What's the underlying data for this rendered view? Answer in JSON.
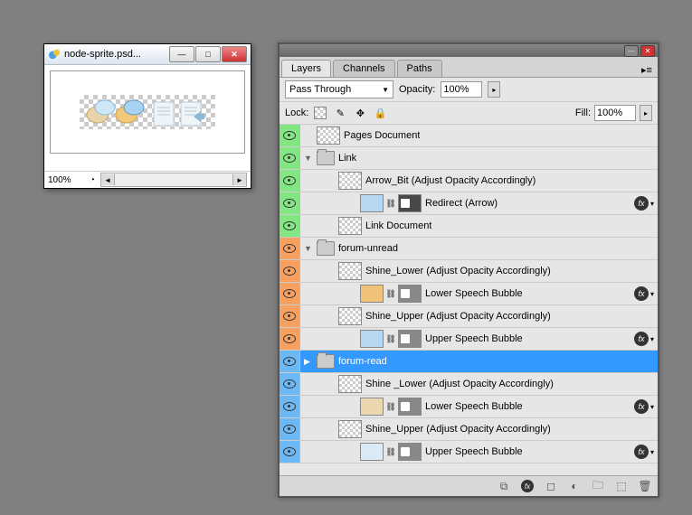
{
  "document_window": {
    "title": "node-sprite.psd...",
    "zoom": "100%"
  },
  "panel": {
    "tabs": [
      "Layers",
      "Channels",
      "Paths"
    ],
    "active_tab": "Layers",
    "blend_mode": "Pass Through",
    "opacity_label": "Opacity:",
    "opacity_value": "100%",
    "lock_label": "Lock:",
    "fill_label": "Fill:",
    "fill_value": "100%"
  },
  "layers": [
    {
      "color": "green",
      "type": "layer",
      "indent": 0,
      "thumb": "trans",
      "name": "Pages Document"
    },
    {
      "color": "green",
      "type": "group",
      "indent": 0,
      "expand": "open",
      "name": "Link"
    },
    {
      "color": "green",
      "type": "layer",
      "indent": 1,
      "thumb": "trans",
      "name": "Arrow_Bit (Adjust Opacity Accordingly)"
    },
    {
      "color": "green",
      "type": "layer",
      "indent": 2,
      "thumb": "#b7d6ef",
      "mask": "dark",
      "name": "Redirect (Arrow)",
      "fx": true
    },
    {
      "color": "green",
      "type": "layer",
      "indent": 1,
      "thumb": "trans",
      "name": "Link Document"
    },
    {
      "color": "orange",
      "type": "group",
      "indent": 0,
      "expand": "open",
      "name": "forum-unread"
    },
    {
      "color": "orange",
      "type": "layer",
      "indent": 1,
      "thumb": "trans",
      "name": "Shine_Lower (Adjust Opacity Accordingly)"
    },
    {
      "color": "orange",
      "type": "layer",
      "indent": 2,
      "thumb": "#f1c27a",
      "mask": "light",
      "name": "Lower Speech Bubble",
      "fx": true
    },
    {
      "color": "orange",
      "type": "layer",
      "indent": 1,
      "thumb": "trans",
      "name": "Shine_Upper (Adjust Opacity Accordingly)"
    },
    {
      "color": "orange",
      "type": "layer",
      "indent": 2,
      "thumb": "#b7d6ef",
      "mask": "light",
      "name": "Upper Speech Bubble",
      "fx": true
    },
    {
      "color": "blue",
      "type": "group",
      "indent": 0,
      "expand": "closed",
      "name": "forum-read",
      "selected": true
    },
    {
      "color": "blue",
      "type": "layer",
      "indent": 1,
      "thumb": "trans",
      "name": "Shine _Lower (Adjust Opacity Accordingly)"
    },
    {
      "color": "blue",
      "type": "layer",
      "indent": 2,
      "thumb": "#ecd8b0",
      "mask": "light",
      "name": "Lower Speech Bubble",
      "fx": true
    },
    {
      "color": "blue",
      "type": "layer",
      "indent": 1,
      "thumb": "trans",
      "name": "Shine_Upper (Adjust Opacity Accordingly)"
    },
    {
      "color": "blue",
      "type": "layer",
      "indent": 2,
      "thumb": "#dbeaf5",
      "mask": "light",
      "name": "Upper Speech Bubble",
      "fx": true
    }
  ]
}
